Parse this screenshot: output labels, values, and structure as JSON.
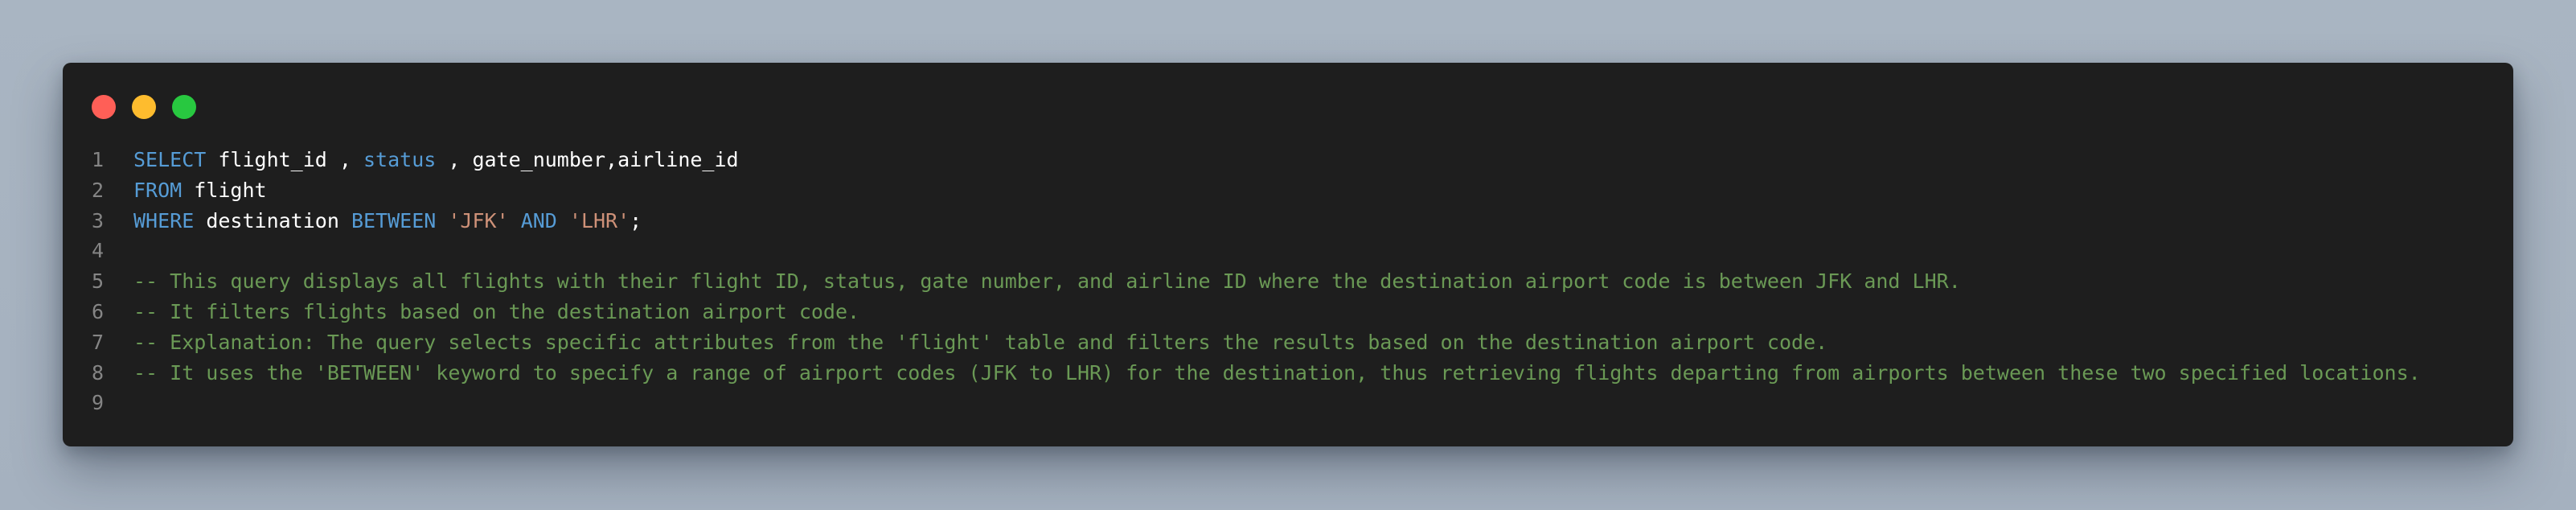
{
  "window": {
    "controls": [
      {
        "name": "close",
        "color": "#ff5f57"
      },
      {
        "name": "minimize",
        "color": "#febc2e"
      },
      {
        "name": "maximize",
        "color": "#28c840"
      }
    ]
  },
  "code": {
    "language": "sql",
    "lines": [
      {
        "number": "1",
        "tokens": [
          {
            "text": "SELECT",
            "type": "keyword"
          },
          {
            "text": " flight_id , ",
            "type": "plain"
          },
          {
            "text": "status",
            "type": "keyword"
          },
          {
            "text": " , gate_number,airline_id",
            "type": "plain"
          }
        ]
      },
      {
        "number": "2",
        "tokens": [
          {
            "text": "FROM",
            "type": "keyword"
          },
          {
            "text": " flight",
            "type": "plain"
          }
        ]
      },
      {
        "number": "3",
        "tokens": [
          {
            "text": "WHERE",
            "type": "keyword"
          },
          {
            "text": " destination ",
            "type": "plain"
          },
          {
            "text": "BETWEEN",
            "type": "keyword"
          },
          {
            "text": " ",
            "type": "plain"
          },
          {
            "text": "'JFK'",
            "type": "string"
          },
          {
            "text": " ",
            "type": "plain"
          },
          {
            "text": "AND",
            "type": "keyword"
          },
          {
            "text": " ",
            "type": "plain"
          },
          {
            "text": "'LHR'",
            "type": "string"
          },
          {
            "text": ";",
            "type": "plain"
          }
        ]
      },
      {
        "number": "4",
        "tokens": []
      },
      {
        "number": "5",
        "tokens": [
          {
            "text": "-- This query displays all flights with their flight ID, status, gate number, and airline ID where the destination airport code is between JFK and LHR.",
            "type": "comment"
          }
        ]
      },
      {
        "number": "6",
        "tokens": [
          {
            "text": "-- It filters flights based on the destination airport code.",
            "type": "comment"
          }
        ]
      },
      {
        "number": "7",
        "tokens": [
          {
            "text": "-- Explanation: The query selects specific attributes from the 'flight' table and filters the results based on the destination airport code.",
            "type": "comment"
          }
        ]
      },
      {
        "number": "8",
        "tokens": [
          {
            "text": "-- It uses the 'BETWEEN' keyword to specify a range of airport codes (JFK to LHR) for the destination, thus retrieving flights departing from airports between these two specified locations.",
            "type": "comment"
          }
        ]
      },
      {
        "number": "9",
        "tokens": []
      }
    ]
  }
}
